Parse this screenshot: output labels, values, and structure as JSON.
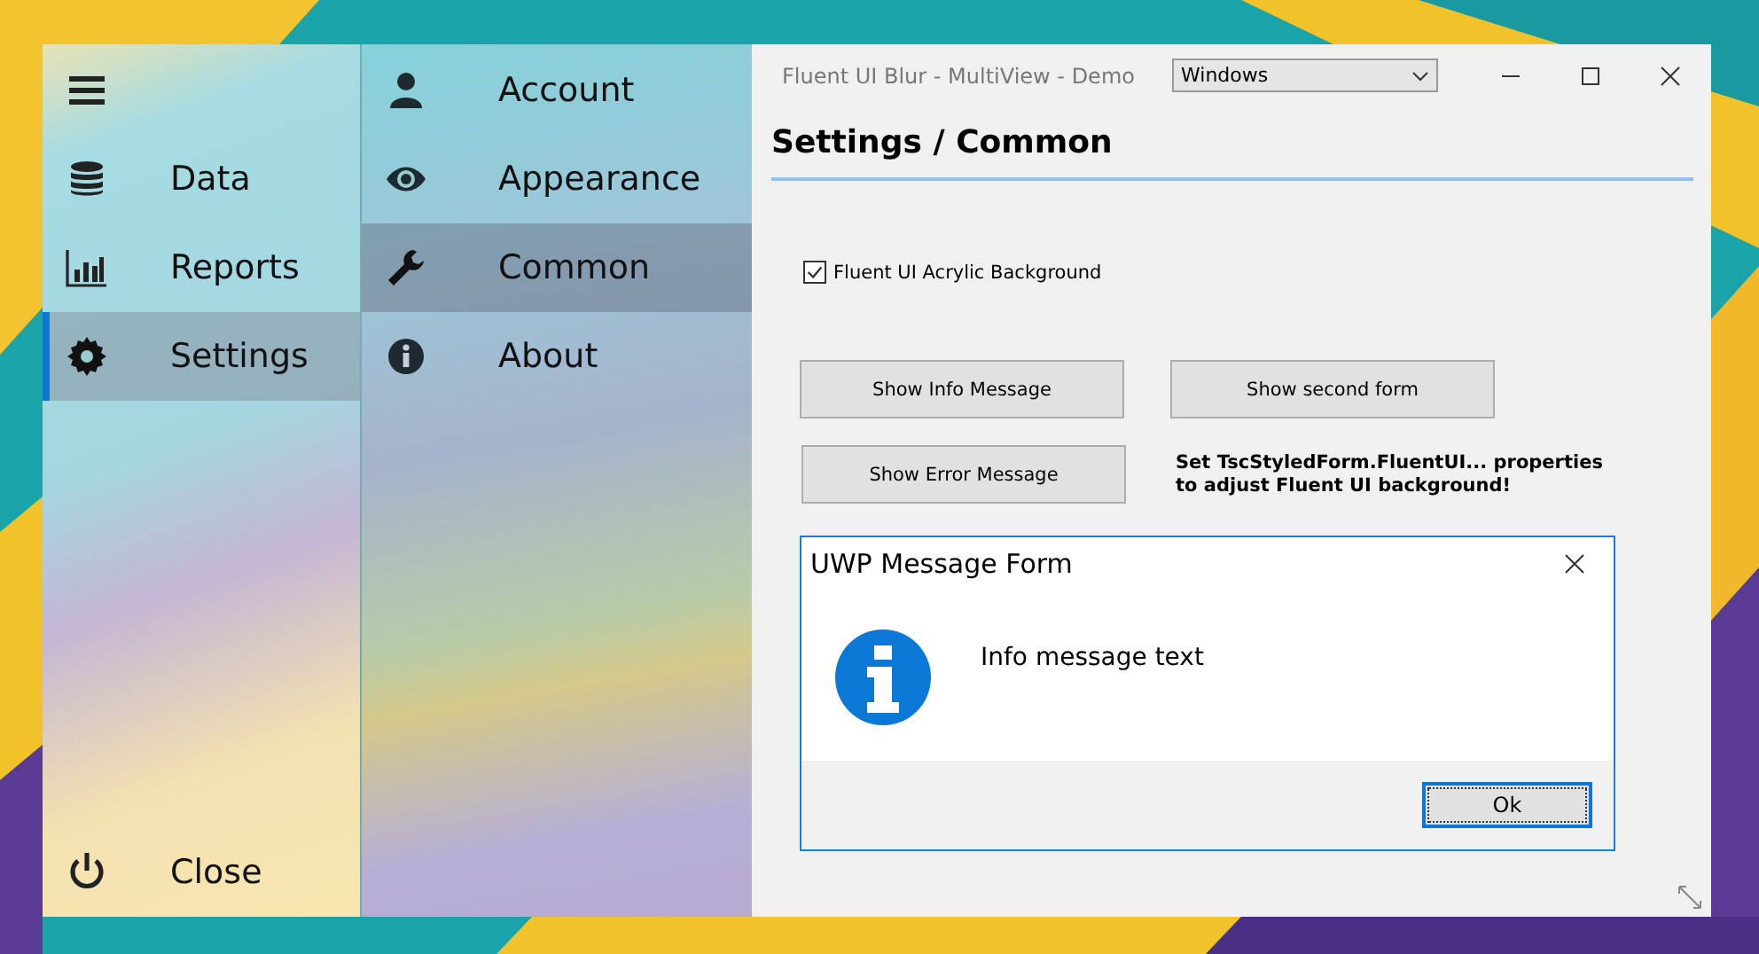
{
  "nav": {
    "items": [
      {
        "kind": "data",
        "label": "Data",
        "selected": false
      },
      {
        "kind": "reports",
        "label": "Reports",
        "selected": false
      },
      {
        "kind": "settings",
        "label": "Settings",
        "selected": true
      }
    ],
    "close": "Close"
  },
  "subnav": {
    "items": [
      {
        "kind": "account",
        "label": "Account",
        "selected": false
      },
      {
        "kind": "appearance",
        "label": "Appearance",
        "selected": false
      },
      {
        "kind": "common",
        "label": "Common",
        "selected": true
      },
      {
        "kind": "about",
        "label": "About",
        "selected": false
      }
    ]
  },
  "window": {
    "title": "Fluent UI Blur - MultiView - Demo",
    "dropdown": {
      "value": "Windows"
    }
  },
  "content": {
    "heading": "Settings / Common",
    "checkbox": {
      "label": "Fluent UI Acrylic Background",
      "checked": true
    },
    "buttons": [
      "Show Info Message",
      "Show second form",
      "Show Error Message"
    ],
    "note": "Set TscStyledForm.FluentUI... properties to adjust Fluent UI background!"
  },
  "dialog": {
    "title": "UWP Message Form",
    "message": "Info message text",
    "button": "Ok"
  }
}
